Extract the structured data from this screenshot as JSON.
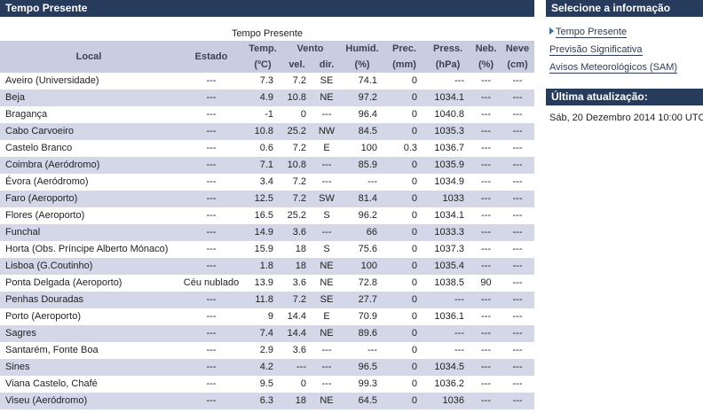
{
  "main": {
    "header_title": "Tempo Presente",
    "table_caption": "Tempo Presente",
    "columns": {
      "local": "Local",
      "estado": "Estado",
      "temp": "Temp.",
      "temp_unit": "(ºC)",
      "vento": "Vento",
      "vel": "vel.",
      "dir": "dir.",
      "humid": "Humid.",
      "humid_unit": "(%)",
      "prec": "Prec.",
      "prec_unit": "(mm)",
      "press": "Press.",
      "press_unit": "(hPa)",
      "neb": "Neb.",
      "neb_unit": "(%)",
      "neve": "Neve",
      "neve_unit": "(cm)"
    },
    "rows": [
      {
        "local": "Aveiro (Universidade)",
        "estado": "---",
        "temp": "7.3",
        "vel": "7.2",
        "dir": "SE",
        "humid": "74.1",
        "prec": "0",
        "press": "---",
        "neb": "---",
        "neve": "---"
      },
      {
        "local": "Beja",
        "estado": "---",
        "temp": "4.9",
        "vel": "10.8",
        "dir": "NE",
        "humid": "97.2",
        "prec": "0",
        "press": "1034.1",
        "neb": "---",
        "neve": "---"
      },
      {
        "local": "Bragança",
        "estado": "---",
        "temp": "-1",
        "vel": "0",
        "dir": "---",
        "humid": "96.4",
        "prec": "0",
        "press": "1040.8",
        "neb": "---",
        "neve": "---"
      },
      {
        "local": "Cabo Carvoeiro",
        "estado": "---",
        "temp": "10.8",
        "vel": "25.2",
        "dir": "NW",
        "humid": "84.5",
        "prec": "0",
        "press": "1035.3",
        "neb": "---",
        "neve": "---"
      },
      {
        "local": "Castelo Branco",
        "estado": "---",
        "temp": "0.6",
        "vel": "7.2",
        "dir": "E",
        "humid": "100",
        "prec": "0.3",
        "press": "1036.7",
        "neb": "---",
        "neve": "---"
      },
      {
        "local": "Coimbra (Aeródromo)",
        "estado": "---",
        "temp": "7.1",
        "vel": "10.8",
        "dir": "---",
        "humid": "85.9",
        "prec": "0",
        "press": "1035.9",
        "neb": "---",
        "neve": "---"
      },
      {
        "local": "Évora (Aeródromo)",
        "estado": "---",
        "temp": "3.4",
        "vel": "7.2",
        "dir": "---",
        "humid": "---",
        "prec": "0",
        "press": "1034.9",
        "neb": "---",
        "neve": "---"
      },
      {
        "local": "Faro (Aeroporto)",
        "estado": "---",
        "temp": "12.5",
        "vel": "7.2",
        "dir": "SW",
        "humid": "81.4",
        "prec": "0",
        "press": "1033",
        "neb": "---",
        "neve": "---"
      },
      {
        "local": "Flores (Aeroporto)",
        "estado": "---",
        "temp": "16.5",
        "vel": "25.2",
        "dir": "S",
        "humid": "96.2",
        "prec": "0",
        "press": "1034.1",
        "neb": "---",
        "neve": "---"
      },
      {
        "local": "Funchal",
        "estado": "---",
        "temp": "14.9",
        "vel": "3.6",
        "dir": "---",
        "humid": "66",
        "prec": "0",
        "press": "1033.3",
        "neb": "---",
        "neve": "---"
      },
      {
        "local": "Horta (Obs. Príncipe Alberto Mónaco)",
        "estado": "---",
        "temp": "15.9",
        "vel": "18",
        "dir": "S",
        "humid": "75.6",
        "prec": "0",
        "press": "1037.3",
        "neb": "---",
        "neve": "---"
      },
      {
        "local": "Lisboa (G.Coutinho)",
        "estado": "---",
        "temp": "1.8",
        "vel": "18",
        "dir": "NE",
        "humid": "100",
        "prec": "0",
        "press": "1035.4",
        "neb": "---",
        "neve": "---"
      },
      {
        "local": "Ponta Delgada (Aeroporto)",
        "estado": "Céu nublado",
        "temp": "13.9",
        "vel": "3.6",
        "dir": "NE",
        "humid": "72.8",
        "prec": "0",
        "press": "1038.5",
        "neb": "90",
        "neve": "---"
      },
      {
        "local": "Penhas Douradas",
        "estado": "---",
        "temp": "11.8",
        "vel": "7.2",
        "dir": "SE",
        "humid": "27.7",
        "prec": "0",
        "press": "---",
        "neb": "---",
        "neve": "---"
      },
      {
        "local": "Porto (Aeroporto)",
        "estado": "---",
        "temp": "9",
        "vel": "14.4",
        "dir": "E",
        "humid": "70.9",
        "prec": "0",
        "press": "1036.1",
        "neb": "---",
        "neve": "---"
      },
      {
        "local": "Sagres",
        "estado": "---",
        "temp": "7.4",
        "vel": "14.4",
        "dir": "NE",
        "humid": "89.6",
        "prec": "0",
        "press": "---",
        "neb": "---",
        "neve": "---"
      },
      {
        "local": "Santarém, Fonte Boa",
        "estado": "---",
        "temp": "2.9",
        "vel": "3.6",
        "dir": "---",
        "humid": "---",
        "prec": "0",
        "press": "---",
        "neb": "---",
        "neve": "---"
      },
      {
        "local": "Sines",
        "estado": "---",
        "temp": "4.2",
        "vel": "---",
        "dir": "---",
        "humid": "96.5",
        "prec": "0",
        "press": "1034.5",
        "neb": "---",
        "neve": "---"
      },
      {
        "local": "Viana Castelo, Chafé",
        "estado": "---",
        "temp": "9.5",
        "vel": "0",
        "dir": "---",
        "humid": "99.3",
        "prec": "0",
        "press": "1036.2",
        "neb": "---",
        "neve": "---"
      },
      {
        "local": "Viseu (Aeródromo)",
        "estado": "---",
        "temp": "6.3",
        "vel": "18",
        "dir": "NE",
        "humid": "64.5",
        "prec": "0",
        "press": "1036",
        "neb": "---",
        "neve": "---"
      }
    ]
  },
  "sidebar": {
    "select_title": "Selecione a informação",
    "menu": [
      {
        "label": "Tempo Presente",
        "active": true
      },
      {
        "label": "Previsão Significativa",
        "active": false
      },
      {
        "label": "Avisos Meteorológicos (SAM)",
        "active": false
      }
    ],
    "update_title": "Última atualização:",
    "update_value": "Sáb, 20 Dezembro 2014 10:00 UTC"
  },
  "colors": {
    "header_bar": "#273b5c",
    "table_header": "#c9cde0",
    "row_stripe": "#d3d7e8"
  }
}
